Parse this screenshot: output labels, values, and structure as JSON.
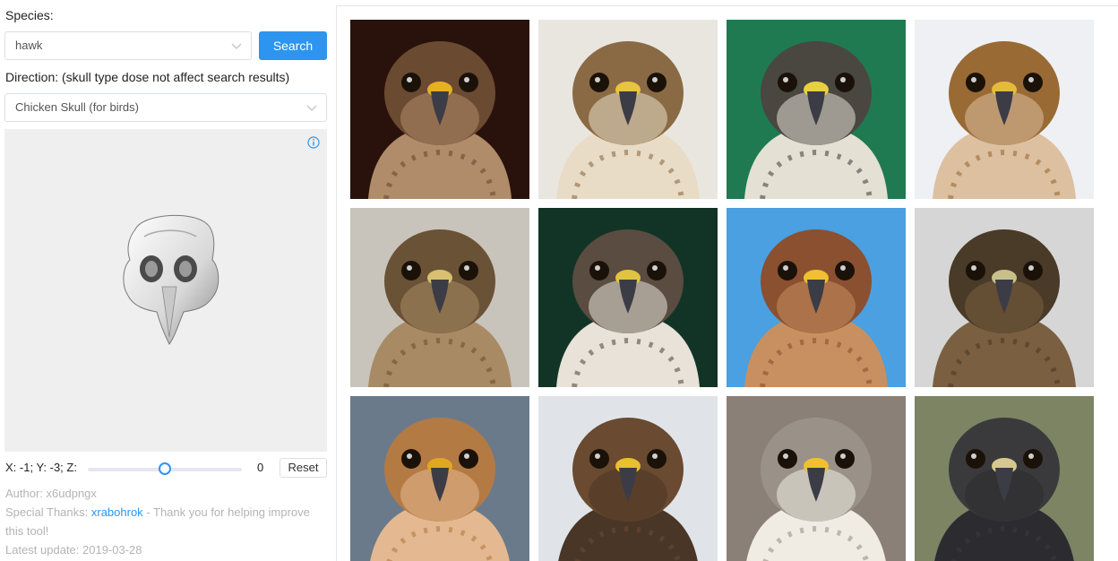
{
  "species": {
    "label": "Species:",
    "value": "hawk",
    "search_label": "Search"
  },
  "direction": {
    "label": "Direction: (skull type dose not affect search results)",
    "skull_value": "Chicken Skull (for birds)"
  },
  "coords": {
    "text": "X: -1; Y: -3; Z:",
    "slider_value": "0",
    "reset_label": "Reset",
    "z_level": 0.5
  },
  "footer": {
    "author": "Author: x6udpngx",
    "thanks_prefix": "Special Thanks: ",
    "thanks_name": "xrabohrok",
    "thanks_suffix": " - Thank you for helping improve this tool!",
    "updated": "Latest update: 2019-03-28"
  },
  "colors": {
    "accent": "#2d95ef"
  },
  "results": [
    {
      "bg": "#2a120c",
      "head": "#6b4a32",
      "chest": "#b08c6a",
      "beak": "#e6b020"
    },
    {
      "bg": "#e9e6e0",
      "head": "#8a6a44",
      "chest": "#e8dcc6",
      "beak": "#e8c440"
    },
    {
      "bg": "#1f7a52",
      "head": "#4a4640",
      "chest": "#e4e0d4",
      "beak": "#e8d040"
    },
    {
      "bg": "#eef0f4",
      "head": "#9a6a34",
      "chest": "#dcc0a0",
      "beak": "#e4bc3a"
    },
    {
      "bg": "#c8c4bc",
      "head": "#6a5236",
      "chest": "#a88a64",
      "beak": "#d8c070"
    },
    {
      "bg": "#123426",
      "head": "#5a4c40",
      "chest": "#e8e2d8",
      "beak": "#e0c440"
    },
    {
      "bg": "#4aa0e0",
      "head": "#8a5030",
      "chest": "#c89060",
      "beak": "#f0c030"
    },
    {
      "bg": "#d6d6d6",
      "head": "#4a3a28",
      "chest": "#7a6040",
      "beak": "#c8c08a"
    },
    {
      "bg": "#6a7a8a",
      "head": "#b47a44",
      "chest": "#e4b890",
      "beak": "#e0a820"
    },
    {
      "bg": "#e0e4e8",
      "head": "#6a4a30",
      "chest": "#4a3626",
      "beak": "#e8c030"
    },
    {
      "bg": "#8a8078",
      "head": "#9a9288",
      "chest": "#f0ece4",
      "beak": "#f0c030"
    },
    {
      "bg": "#7c8464",
      "head": "#3a3a3c",
      "chest": "#2c2c30",
      "beak": "#d8c890"
    }
  ]
}
